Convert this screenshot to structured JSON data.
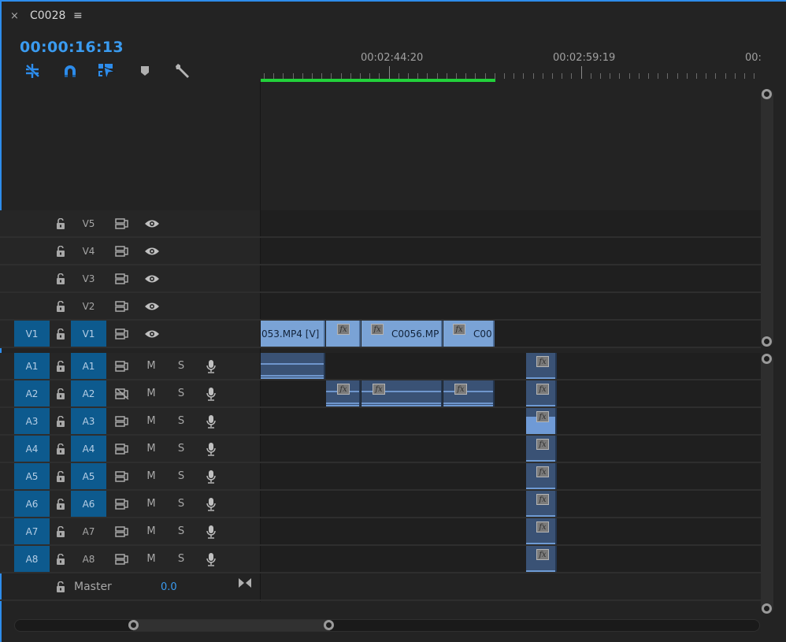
{
  "panel": {
    "close_glyph": "×",
    "sequence_name": "C0028",
    "menu_glyph": "≡",
    "timecode": "00:00:16:13"
  },
  "toolbar": {
    "tools": [
      {
        "name": "insert-nest-icon",
        "active": true
      },
      {
        "name": "snap-magnet-icon",
        "active": true
      },
      {
        "name": "linked-selection-icon",
        "active": true
      },
      {
        "name": "add-marker-icon",
        "active": false
      },
      {
        "name": "wrench-settings-icon",
        "active": false
      }
    ]
  },
  "ruler": {
    "labels": [
      "00:02:44:20",
      "00:02:59:19",
      "00:"
    ]
  },
  "video_tracks": [
    {
      "source": "",
      "target": "V5",
      "target_on": false
    },
    {
      "source": "",
      "target": "V4",
      "target_on": false
    },
    {
      "source": "",
      "target": "V3",
      "target_on": false
    },
    {
      "source": "",
      "target": "V2",
      "target_on": false
    },
    {
      "source": "V1",
      "target": "V1",
      "target_on": true
    }
  ],
  "audio_tracks": [
    {
      "source": "A1",
      "target": "A1",
      "target_on": true,
      "sync_lock_off": false
    },
    {
      "source": "A2",
      "target": "A2",
      "target_on": true,
      "sync_lock_off": true
    },
    {
      "source": "A3",
      "target": "A3",
      "target_on": true,
      "sync_lock_off": false
    },
    {
      "source": "A4",
      "target": "A4",
      "target_on": true,
      "sync_lock_off": false
    },
    {
      "source": "A5",
      "target": "A5",
      "target_on": true,
      "sync_lock_off": false
    },
    {
      "source": "A6",
      "target": "A6",
      "target_on": true,
      "sync_lock_off": false
    },
    {
      "source": "A7",
      "target": "A7",
      "target_on": false,
      "sync_lock_off": false
    },
    {
      "source": "A8",
      "target": "A8",
      "target_on": false,
      "sync_lock_off": false
    }
  ],
  "track_buttons": {
    "mute": "M",
    "solo": "S",
    "fx_label": "fx"
  },
  "master": {
    "label": "Master",
    "value": "0.0"
  },
  "clips": {
    "v1": [
      {
        "label": "053.MP4 [V]",
        "fx": false
      },
      {
        "label": "",
        "fx": true
      },
      {
        "label": "C0056.MP",
        "fx": true
      },
      {
        "label": "C00",
        "fx": true
      }
    ]
  }
}
